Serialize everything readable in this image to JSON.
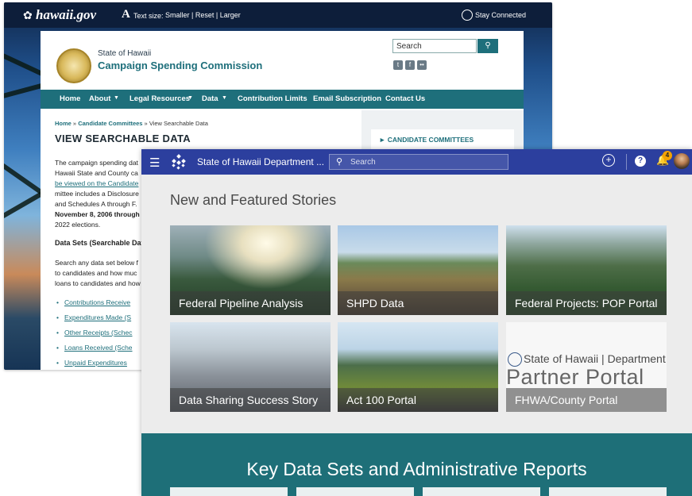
{
  "campaign_site": {
    "top_bar": {
      "logo": "hawaii.gov",
      "text_size_label": "Text size:",
      "text_size_links": "Smaller | Reset | Larger",
      "stay_connected": "Stay Connected"
    },
    "header": {
      "state": "State of Hawaii",
      "commission": "Campaign Spending Commission",
      "search_placeholder": "Search"
    },
    "nav": [
      "Home",
      "About",
      "Legal Resources",
      "Data",
      "Contribution Limits",
      "Email Subscription",
      "Contact Us"
    ],
    "breadcrumb": {
      "home": "Home",
      "separator1": " » ",
      "committees": "Candidate Committees",
      "separator2": " » ",
      "current": "View Searchable Data"
    },
    "title": "VIEW SEARCHABLE DATA",
    "body_lines": [
      "The campaign spending dat",
      "Hawaii State and County ca",
      "be viewed on the Candidate",
      "mittee includes a Disclosure",
      "and Schedules A through F.",
      "November 8, 2006 through",
      "2022 elections."
    ],
    "datasets_heading": "Data Sets (Searchable Dat",
    "search_desc_lines": [
      "Search any data set below f",
      "to candidates and how muc",
      "loans to candidates and how"
    ],
    "dataset_links": [
      "Contributions Receive",
      "Expenditures Made (S",
      "Other Receipts (Schec",
      "Loans Received (Sche",
      "Unpaid Expenditures"
    ],
    "sidebar_item": "► CANDIDATE COMMITTEES"
  },
  "portal": {
    "topbar": {
      "title": "State of Hawaii Department ...",
      "search_placeholder": "Search",
      "notification_count": "4"
    },
    "heading": "New and Featured Stories",
    "tiles": [
      {
        "caption": "Federal Pipeline Analysis"
      },
      {
        "caption": "SHPD Data"
      },
      {
        "caption": "Federal Projects: POP Portal"
      },
      {
        "caption": "Data Sharing Success Story"
      },
      {
        "caption": "Act 100 Portal"
      },
      {
        "caption": "FHWA/County Portal",
        "image_state": "State of Hawaii | Department c",
        "image_portal": "Partner Portal"
      }
    ],
    "key_data_title": "Key Data Sets and Administrative Reports"
  }
}
